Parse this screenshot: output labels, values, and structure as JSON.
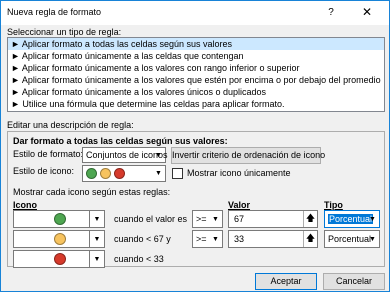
{
  "window": {
    "title": "Nueva regla de formato",
    "help_label": "?",
    "close_label": "✕"
  },
  "rule_type": {
    "label": "Seleccionar un tipo de regla:",
    "items": [
      {
        "label": "► Aplicar formato a todas las celdas según sus valores",
        "selected": true
      },
      {
        "label": "► Aplicar formato únicamente a las celdas que contengan",
        "selected": false
      },
      {
        "label": "► Aplicar formato únicamente a los valores con rango inferior o superior",
        "selected": false
      },
      {
        "label": "► Aplicar formato únicamente a los valores que estén por encima o por debajo del promedio",
        "selected": false
      },
      {
        "label": "► Aplicar formato únicamente a los valores únicos o duplicados",
        "selected": false
      },
      {
        "label": "► Utilice una fórmula que determine las celdas para aplicar formato.",
        "selected": false
      }
    ]
  },
  "description": {
    "label": "Editar una descripción de regla:",
    "heading": "Dar formato a todas las celdas según sus valores:",
    "format_style_label": "Estilo de formato:",
    "format_style_value": "Conjuntos de iconos",
    "reverse_button": "Invertir criterio de ordenación de icono",
    "icon_style_label": "Estilo de icono:",
    "show_icon_only_label": "Mostrar icono únicamente",
    "show_icon_only_checked": false,
    "rules_label": "Mostrar cada icono según estas reglas:",
    "col_icon": "Icono",
    "col_value": "Valor",
    "col_type": "Tipo",
    "icon_set_colors": [
      "#4ea651",
      "#f7c35f",
      "#d63a2b"
    ],
    "rows": [
      {
        "icon_color": "#4ea651",
        "condition": "cuando el valor es",
        "operator": ">=",
        "value": "67",
        "type": "Porcentual"
      },
      {
        "icon_color": "#f7c35f",
        "condition": "cuando < 67 y",
        "operator": ">=",
        "value": "33",
        "type": "Porcentual"
      },
      {
        "icon_color": "#d63a2b",
        "condition": "cuando < 33"
      }
    ]
  },
  "buttons": {
    "ok": "Aceptar",
    "cancel": "Cancelar"
  }
}
